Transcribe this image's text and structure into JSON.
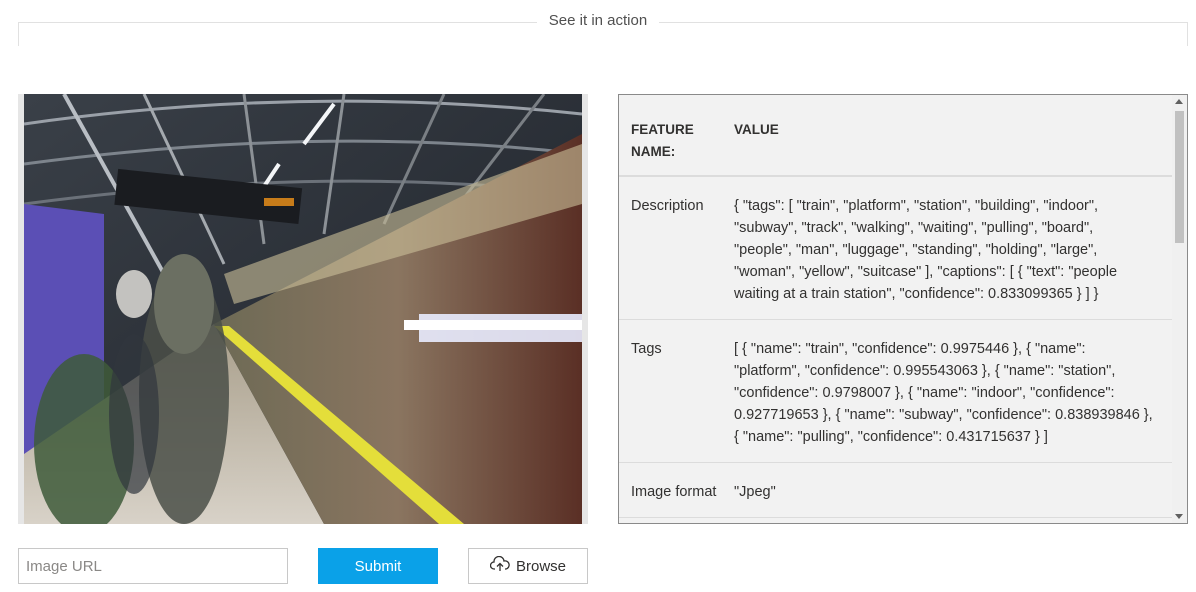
{
  "section": {
    "title": "See it in action"
  },
  "table": {
    "headers": {
      "feature": "FEATURE NAME:",
      "value": "VALUE"
    },
    "rows": [
      {
        "name": "Description",
        "value": "{ \"tags\": [ \"train\", \"platform\", \"station\", \"building\", \"indoor\", \"subway\", \"track\", \"walking\", \"waiting\", \"pulling\", \"board\", \"people\", \"man\", \"luggage\", \"standing\", \"holding\", \"large\", \"woman\", \"yellow\", \"suitcase\" ], \"captions\": [ { \"text\": \"people waiting at a train station\", \"confidence\": 0.833099365 } ] }"
      },
      {
        "name": "Tags",
        "value": "[ { \"name\": \"train\", \"confidence\": 0.9975446 }, { \"name\": \"platform\", \"confidence\": 0.995543063 }, { \"name\": \"station\", \"confidence\": 0.9798007 }, { \"name\": \"indoor\", \"confidence\": 0.927719653 }, { \"name\": \"subway\", \"confidence\": 0.838939846 }, { \"name\": \"pulling\", \"confidence\": 0.431715637 } ]"
      },
      {
        "name": "Image format",
        "value": "\"Jpeg\""
      }
    ]
  },
  "controls": {
    "url_placeholder": "Image URL",
    "submit_label": "Submit",
    "browse_label": "Browse"
  },
  "icons": {
    "browse": "cloud-upload-icon"
  },
  "colors": {
    "submit_bg": "#0aa1e8",
    "panel_bg": "#f2f2f2"
  }
}
